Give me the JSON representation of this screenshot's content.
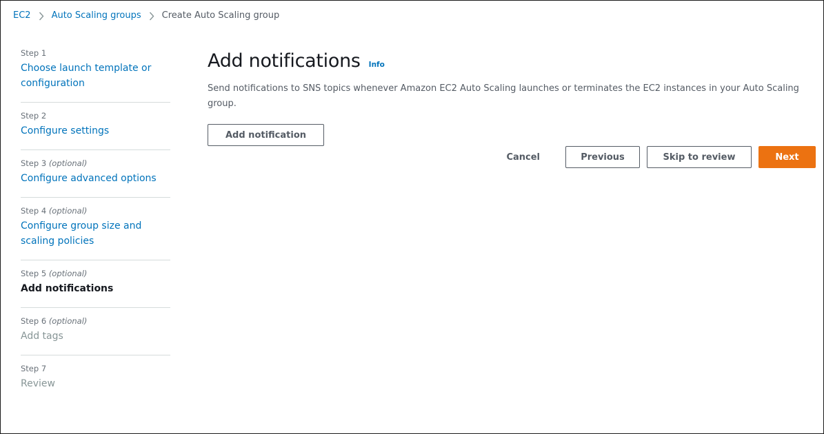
{
  "breadcrumb": {
    "items": [
      "EC2",
      "Auto Scaling groups",
      "Create Auto Scaling group"
    ]
  },
  "steps": [
    {
      "label": "Step 1",
      "optional": "",
      "title": "Choose launch template or configuration",
      "state": "link"
    },
    {
      "label": "Step 2",
      "optional": "",
      "title": "Configure settings",
      "state": "link"
    },
    {
      "label": "Step 3",
      "optional": "(optional)",
      "title": "Configure advanced options",
      "state": "link"
    },
    {
      "label": "Step 4",
      "optional": "(optional)",
      "title": "Configure group size and scaling policies",
      "state": "link"
    },
    {
      "label": "Step 5",
      "optional": "(optional)",
      "title": "Add notifications",
      "state": "active"
    },
    {
      "label": "Step 6",
      "optional": "(optional)",
      "title": "Add tags",
      "state": "disabled"
    },
    {
      "label": "Step 7",
      "optional": "",
      "title": "Review",
      "state": "disabled"
    }
  ],
  "main": {
    "title": "Add notifications",
    "info_label": "Info",
    "description": "Send notifications to SNS topics whenever Amazon EC2 Auto Scaling launches or terminates the EC2 instances in your Auto Scaling group.",
    "add_notification_label": "Add notification"
  },
  "actions": {
    "cancel_label": "Cancel",
    "previous_label": "Previous",
    "skip_label": "Skip to review",
    "next_label": "Next"
  },
  "colors": {
    "link": "#0073bb",
    "primary_button": "#ec7211",
    "text": "#16191f",
    "secondary_text": "#545b64",
    "divider": "#d5dbdb"
  },
  "icons": {
    "breadcrumb_separator": "chevron-right-icon"
  }
}
